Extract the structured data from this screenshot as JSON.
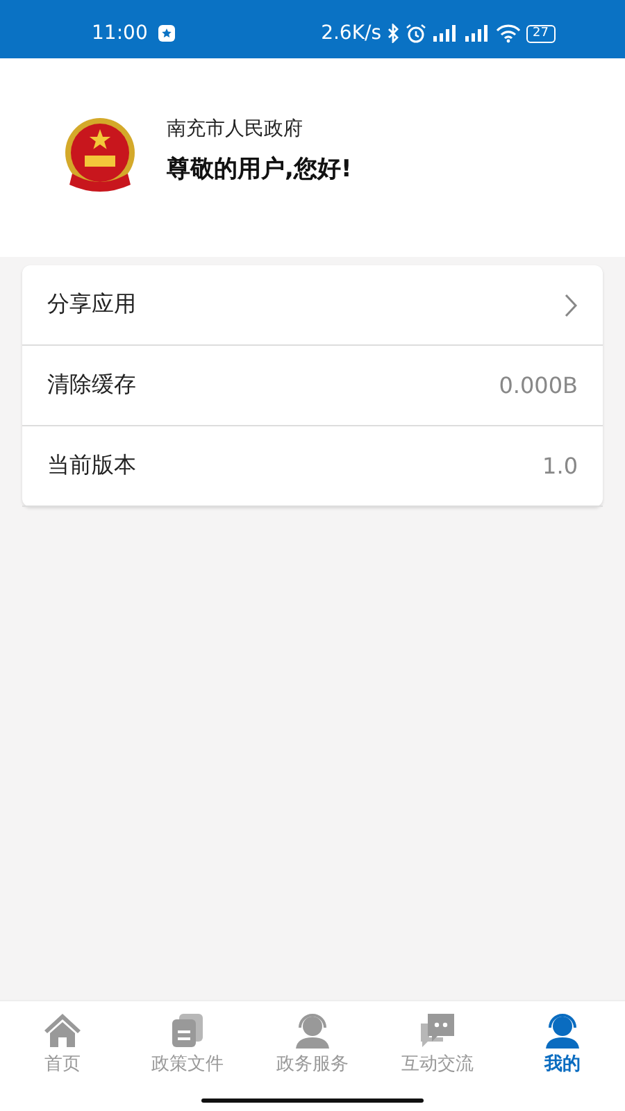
{
  "status_bar": {
    "time": "11:00",
    "speed": "2.6K/s",
    "battery": "27"
  },
  "header": {
    "org": "南充市人民政府",
    "greeting": "尊敬的用户,您好!"
  },
  "menu": [
    {
      "label": "分享应用",
      "kind": "arrow"
    },
    {
      "label": "清除缓存",
      "kind": "value",
      "value": "0.000B"
    },
    {
      "label": "当前版本",
      "kind": "value",
      "value": "1.0"
    }
  ],
  "tabs": [
    {
      "label": "首页",
      "kind": "home",
      "selected": false
    },
    {
      "label": "政策文件",
      "kind": "doc",
      "selected": false
    },
    {
      "label": "政务服务",
      "kind": "person",
      "selected": false
    },
    {
      "label": "互动交流",
      "kind": "chat",
      "selected": false
    },
    {
      "label": "我的",
      "kind": "person",
      "selected": true
    }
  ]
}
